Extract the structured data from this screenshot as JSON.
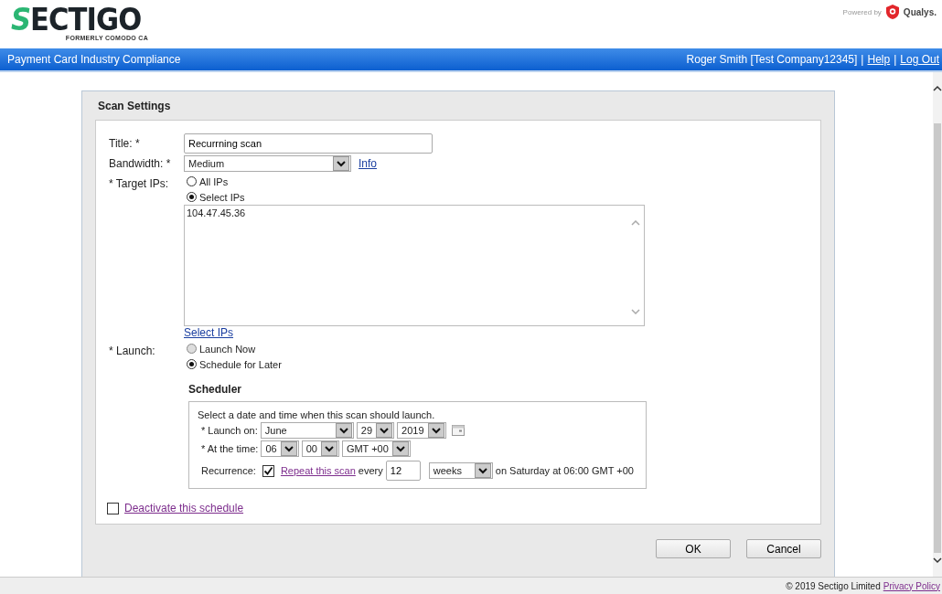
{
  "header": {
    "logo_mark": "S",
    "logo_name": "ECTIGO",
    "logo_tagline": "FORMERLY COMODO CA",
    "powered_by": "Powered by",
    "partner": "Qualys."
  },
  "nav_bar": {
    "title": "Payment Card Industry Compliance",
    "user": "Roger Smith [Test Company12345]",
    "separator": "|",
    "links": [
      "Help",
      "Log Out"
    ]
  },
  "dialog": {
    "title": "Scan Settings",
    "title_field": {
      "label": "Title: *",
      "value": "Recurrning scan"
    },
    "bandwidth": {
      "label": "Bandwidth: *",
      "value": "Medium",
      "info_link": "Info"
    },
    "target_ips": {
      "label": "* Target IPs:",
      "options": [
        {
          "label": "All IPs",
          "selected": false,
          "disabled": false
        },
        {
          "label": "Select IPs",
          "selected": true,
          "disabled": false
        }
      ],
      "ips": "104.47.45.36",
      "select_link": "Select IPs"
    },
    "launch": {
      "label": "* Launch:",
      "options": [
        {
          "label": "Launch Now",
          "selected": false,
          "disabled": true
        },
        {
          "label": "Schedule for Later",
          "selected": true,
          "disabled": false
        }
      ]
    },
    "scheduler": {
      "title": "Scheduler",
      "intro": "Select a date and time when this scan should launch.",
      "launch_on_label": "* Launch on:",
      "month": "June",
      "day": "29",
      "year": "2019",
      "time_label": "* At the time:",
      "hour": "06",
      "minute": "00",
      "timezone": "GMT +00",
      "recurrence_label": "Recurrence:",
      "repeat_checked": true,
      "repeat_link": "Repeat this scan",
      "every": "every",
      "interval": "12",
      "unit": "weeks",
      "summary": "on Saturday at 06:00 GMT +00"
    },
    "deactivate": {
      "label": "Deactivate this schedule",
      "checked": false
    },
    "buttons": [
      "OK",
      "Cancel"
    ]
  },
  "footer": {
    "copyright": "© 2019 Sectigo Limited",
    "link": "Privacy Policy"
  }
}
